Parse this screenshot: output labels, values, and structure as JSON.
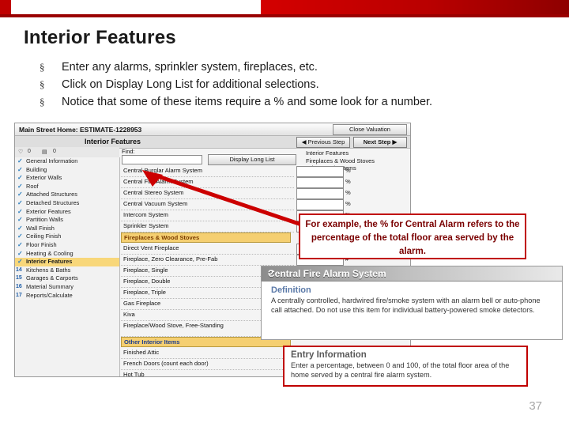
{
  "slide": {
    "title": "Interior Features",
    "page_number": "37",
    "bullet_mark": "§",
    "bullets": [
      "Enter any alarms, sprinkler system, fireplaces, etc.",
      "Click on Display Long List for additional selections.",
      "Notice that some of these items require a % and some look for a number."
    ]
  },
  "app": {
    "titlebar": {
      "title": "Main Street Home: ESTIMATE-1228953",
      "close_button": "Close Valuation"
    },
    "subbar": {
      "panel_name": "Interior Features",
      "prev_button": "◀ Previous Step",
      "next_button": "Next Step ▶"
    },
    "toolstrip": {
      "item1": "0",
      "item2": "0"
    },
    "find": {
      "label": "Find:",
      "value": "",
      "long_list_button": "Display Long List"
    },
    "leftnav": [
      {
        "label": "General Information",
        "marker": "check",
        "selected": false
      },
      {
        "label": "Building",
        "marker": "check",
        "selected": false
      },
      {
        "label": "Exterior Walls",
        "marker": "check",
        "selected": false
      },
      {
        "label": "Roof",
        "marker": "check",
        "selected": false
      },
      {
        "label": "Attached Structures",
        "marker": "check",
        "selected": false
      },
      {
        "label": "Detached Structures",
        "marker": "check",
        "selected": false
      },
      {
        "label": "Exterior Features",
        "marker": "check",
        "selected": false
      },
      {
        "label": "Partition Walls",
        "marker": "check",
        "selected": false
      },
      {
        "label": "Wall Finish",
        "marker": "check",
        "selected": false
      },
      {
        "label": "Ceiling Finish",
        "marker": "check",
        "selected": false
      },
      {
        "label": "Floor Finish",
        "marker": "check",
        "selected": false
      },
      {
        "label": "Heating & Cooling",
        "marker": "check",
        "selected": false
      },
      {
        "label": "Interior Features",
        "marker": "check",
        "selected": true
      },
      {
        "label": "Kitchens & Baths",
        "marker": "14",
        "selected": false
      },
      {
        "label": "Garages & Carports",
        "marker": "15",
        "selected": false
      },
      {
        "label": "Material Summary",
        "marker": "16",
        "selected": false
      },
      {
        "label": "Reports/Calculate",
        "marker": "17",
        "selected": false
      }
    ],
    "minilist": [
      "Interior Features",
      "Fireplaces & Wood Stoves",
      "Other Interior Items"
    ],
    "sections": [
      {
        "header": null,
        "rows": [
          {
            "label": "Central Burglar Alarm System",
            "unit": "%"
          },
          {
            "label": "Central Fire Alarm System",
            "unit": "%"
          },
          {
            "label": "Central Stereo System",
            "unit": "%"
          },
          {
            "label": "Central Vacuum System",
            "unit": "%"
          },
          {
            "label": "Intercom System",
            "unit": "%"
          },
          {
            "label": "Sprinkler System",
            "unit": "%"
          }
        ]
      },
      {
        "header": "Fireplaces & Wood Stoves",
        "header_style": "orange",
        "rows": [
          {
            "label": "Direct Vent Fireplace",
            "unit": "#"
          },
          {
            "label": "Fireplace, Zero Clearance, Pre-Fab",
            "unit": "#"
          },
          {
            "label": "Fireplace, Single",
            "unit": ""
          },
          {
            "label": "Fireplace, Double",
            "unit": ""
          },
          {
            "label": "Fireplace, Triple",
            "unit": ""
          },
          {
            "label": "Gas Fireplace",
            "unit": ""
          },
          {
            "label": "Kiva",
            "unit": ""
          },
          {
            "label": "Fireplace/Wood Stove, Free-Standing",
            "unit": ""
          }
        ]
      },
      {
        "header": "Other Interior Items",
        "header_style": "blue",
        "rows": [
          {
            "label": "Finished Attic",
            "unit": ""
          },
          {
            "label": "French Doors (count each door)",
            "unit": ""
          },
          {
            "label": "Hot Tub",
            "unit": ""
          }
        ]
      }
    ]
  },
  "callout": {
    "text": "For example, the % for Central Alarm refers to the percentage of the total floor area served by the alarm."
  },
  "helpcard": {
    "title": "Central Fire Alarm System",
    "help_icon": "?",
    "definition_heading": "Definition",
    "definition_body": "A centrally controlled, hardwired fire/smoke system with an alarm bell or auto-phone call attached. Do not use this item for individual battery-powered smoke detectors."
  },
  "entrycard": {
    "title": "Entry Information",
    "body": "Enter a percentage, between 0 and 100, of the total floor area of the home served by a central fire alarm system."
  },
  "colors": {
    "accent_red": "#c00000",
    "highlight": "#f8d77a"
  }
}
